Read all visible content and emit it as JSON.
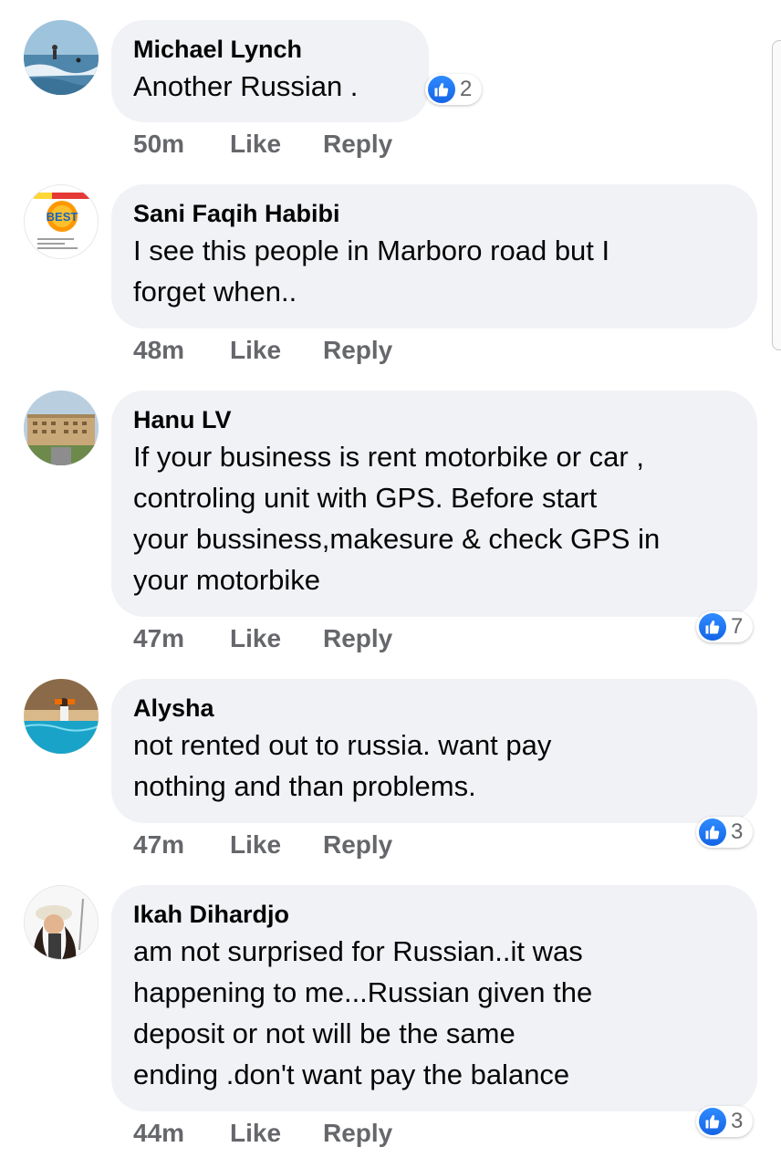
{
  "comments": [
    {
      "name": "Michael Lynch",
      "lines": [
        "Another  Russian ."
      ],
      "time": "50m",
      "like": "Like",
      "reply": "Reply",
      "reaction_count": "2"
    },
    {
      "name": "Sani Faqih Habibi",
      "lines": [
        "I see this people in Marboro road but I",
        "forget when.."
      ],
      "time": "48m",
      "like": "Like",
      "reply": "Reply"
    },
    {
      "name": "Hanu LV",
      "lines": [
        "If your business is rent motorbike or car ,",
        "controling unit with GPS. Before start",
        "your bussiness,makesure & check GPS in",
        "your  motorbike"
      ],
      "time": "47m",
      "like": "Like",
      "reply": "Reply",
      "reaction_count": "7"
    },
    {
      "name": "Alysha",
      "lines": [
        "not rented out to russia. want pay",
        "nothing and than problems."
      ],
      "time": "47m",
      "like": "Like",
      "reply": "Reply",
      "reaction_count": "3"
    },
    {
      "name": "Ikah Dihardjo",
      "lines": [
        "am not surprised for Russian..it was",
        "happening to me...Russian given the",
        "deposit or not will be the same",
        "ending .don't want pay the balance"
      ],
      "time": "44m",
      "like": "Like",
      "reply": "Reply",
      "reaction_count": "3"
    }
  ],
  "avatar_logo_text": "BEST",
  "colors": {
    "bubble": "#f0f2f5",
    "meta": "#65676b",
    "like_blue": "#1877f2"
  },
  "icons": {
    "reaction": "thumbs-up-icon"
  }
}
